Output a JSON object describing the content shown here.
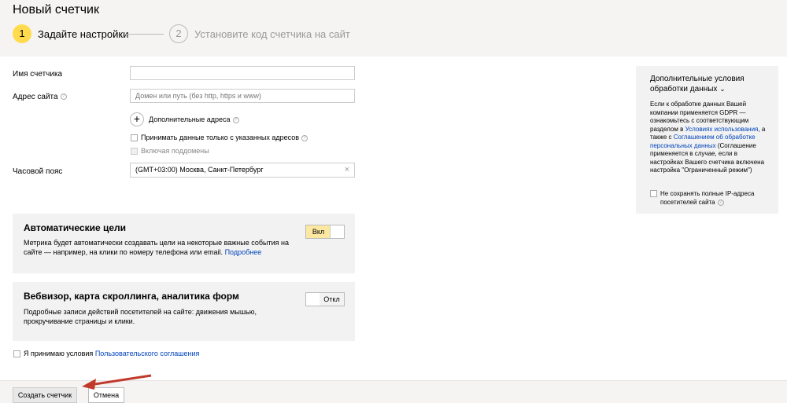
{
  "page": {
    "title": "Новый счетчик"
  },
  "steps": [
    {
      "number": "1",
      "label": "Задайте настройки"
    },
    {
      "number": "2",
      "label": "Установите код счетчика на сайт"
    }
  ],
  "form": {
    "counter_name_label": "Имя счетчика",
    "counter_name_value": "",
    "site_address_label": "Адрес сайта",
    "site_address_placeholder": "Домен или путь (без http, https и www)",
    "additional_addresses_label": "Дополнительные адреса",
    "accept_only_label": "Принимать данные только с указанных адресов",
    "include_subdomains_label": "Включая поддомены",
    "timezone_label": "Часовой пояс",
    "timezone_value": "(GMT+03:00) Москва, Санкт-Петербург"
  },
  "auto_goals": {
    "title": "Автоматические цели",
    "description": "Метрика будет автоматически создавать цели на некоторые важные события на сайте — например, на клики по номеру телефона или email.",
    "link": "Подробнее",
    "toggle_label": "Вкл",
    "enabled": true
  },
  "webvisor": {
    "title": "Вебвизор, карта скроллинга, аналитика форм",
    "description": "Подробные записи действий посетителей на сайте: движения мышью, прокручивание страницы и клики.",
    "toggle_label": "Откл",
    "enabled": false
  },
  "agreement": {
    "text": "Я принимаю условия",
    "link": "Пользовательского соглашения"
  },
  "gdpr": {
    "title": "Дополнительные условия обработки данных",
    "text_1": "Если к обработке данных Вашей компании применяется GDPR — ознакомьтесь с соответствующим разделом в",
    "link_1": "Условиях использования",
    "text_2": ", а также с",
    "link_2": "Соглашением об обработке персональных данных",
    "text_3": "(Соглашение применяется в случае, если в настройках Вашего счетчика включена настройка \"Ограниченный режим\")",
    "checkbox_label": "Не сохранять полные IP-адреса посетителей сайта"
  },
  "footer": {
    "create_label": "Создать счетчик",
    "cancel_label": "Отмена"
  },
  "colors": {
    "accent": "#ffdb4d",
    "link": "#0044bb",
    "toggle_on": "#fce8a1",
    "arrow": "#c0392b"
  }
}
